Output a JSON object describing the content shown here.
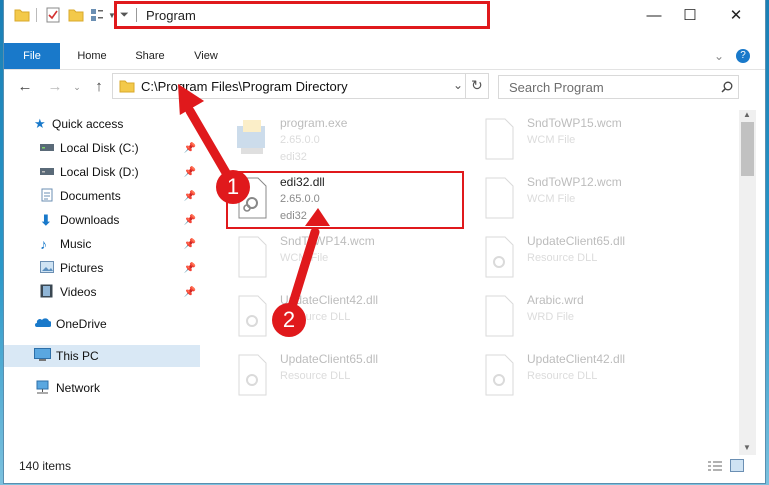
{
  "window": {
    "title": "Program",
    "controls": {
      "minimize": "—",
      "maximize": "☐",
      "close": "✕"
    }
  },
  "ribbon": {
    "tabs": [
      "File",
      "Home",
      "Share",
      "View"
    ]
  },
  "navbar": {
    "address": "C:\\Program Files\\Program Directory",
    "search_placeholder": "Search Program"
  },
  "navpane": {
    "items": [
      {
        "label": "Quick access",
        "icon": "star-icon",
        "pinned": false
      },
      {
        "label": "Local Disk (C:)",
        "icon": "drive-icon",
        "pinned": true
      },
      {
        "label": "Local Disk (D:)",
        "icon": "drive-icon",
        "pinned": true
      },
      {
        "label": "Documents",
        "icon": "documents-icon",
        "pinned": true
      },
      {
        "label": "Downloads",
        "icon": "download-icon",
        "pinned": true
      },
      {
        "label": "Music",
        "icon": "music-icon",
        "pinned": true
      },
      {
        "label": "Pictures",
        "icon": "pictures-icon",
        "pinned": true
      },
      {
        "label": "Videos",
        "icon": "videos-icon",
        "pinned": true
      },
      {
        "label": "OneDrive",
        "icon": "cloud-icon",
        "pinned": false
      },
      {
        "label": "This PC",
        "icon": "computer-icon",
        "pinned": false,
        "selected": true
      },
      {
        "label": "Network",
        "icon": "network-icon",
        "pinned": false
      }
    ]
  },
  "files": [
    {
      "name": "program.exe",
      "line2": "2.65.0.0",
      "line3": "edi32",
      "faded": true
    },
    {
      "name": "SndToWP15.wcm",
      "line2": "WCM File",
      "line3": "",
      "faded": true
    },
    {
      "name": "edi32.dll",
      "line2": "2.65.0.0",
      "line3": "edi32",
      "faded": false,
      "highlighted": true
    },
    {
      "name": "SndToWP12.wcm",
      "line2": "WCM File",
      "line3": "",
      "faded": true
    },
    {
      "name": "SndToWP14.wcm",
      "line2": "WCM File",
      "line3": "",
      "faded": true
    },
    {
      "name": "UpdateClient65.dll",
      "line2": "Resource DLL",
      "line3": "",
      "faded": true
    },
    {
      "name": "UpdateClient42.dll",
      "line2": "Resource DLL",
      "line3": "",
      "faded": true
    },
    {
      "name": "Arabic.wrd",
      "line2": "WRD File",
      "line3": "",
      "faded": true
    },
    {
      "name": "UpdateClient65.dll",
      "line2": "Resource DLL",
      "line3": "",
      "faded": true
    },
    {
      "name": "UpdateClient42.dll",
      "line2": "Resource DLL",
      "line3": "",
      "faded": true
    }
  ],
  "status": {
    "count": "140 items"
  },
  "annotations": {
    "step1": "1",
    "step2": "2",
    "color": "#e0191c"
  }
}
